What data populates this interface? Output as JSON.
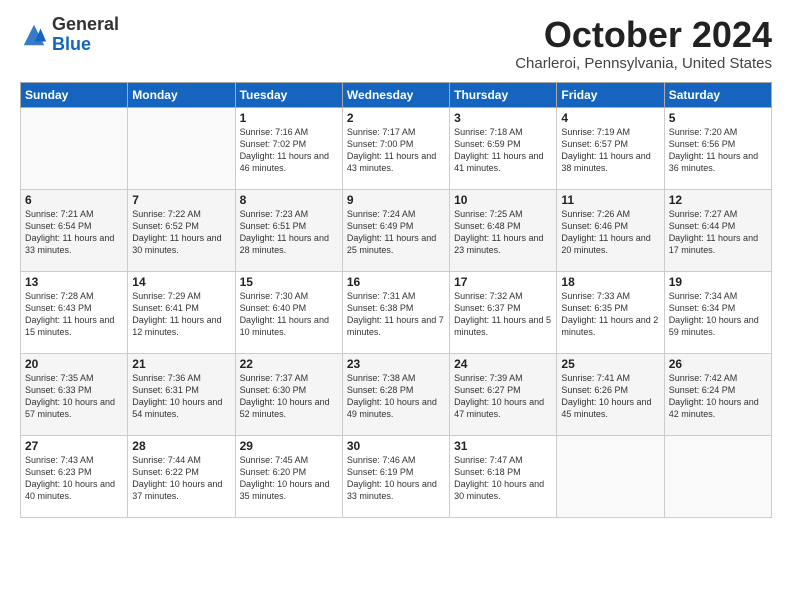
{
  "logo": {
    "general": "General",
    "blue": "Blue"
  },
  "header": {
    "month": "October 2024",
    "location": "Charleroi, Pennsylvania, United States"
  },
  "days_of_week": [
    "Sunday",
    "Monday",
    "Tuesday",
    "Wednesday",
    "Thursday",
    "Friday",
    "Saturday"
  ],
  "weeks": [
    [
      {
        "day": null
      },
      {
        "day": null
      },
      {
        "day": 1,
        "sunrise": "7:16 AM",
        "sunset": "7:02 PM",
        "daylight": "11 hours and 46 minutes."
      },
      {
        "day": 2,
        "sunrise": "7:17 AM",
        "sunset": "7:00 PM",
        "daylight": "11 hours and 43 minutes."
      },
      {
        "day": 3,
        "sunrise": "7:18 AM",
        "sunset": "6:59 PM",
        "daylight": "11 hours and 41 minutes."
      },
      {
        "day": 4,
        "sunrise": "7:19 AM",
        "sunset": "6:57 PM",
        "daylight": "11 hours and 38 minutes."
      },
      {
        "day": 5,
        "sunrise": "7:20 AM",
        "sunset": "6:56 PM",
        "daylight": "11 hours and 36 minutes."
      }
    ],
    [
      {
        "day": 6,
        "sunrise": "7:21 AM",
        "sunset": "6:54 PM",
        "daylight": "11 hours and 33 minutes."
      },
      {
        "day": 7,
        "sunrise": "7:22 AM",
        "sunset": "6:52 PM",
        "daylight": "11 hours and 30 minutes."
      },
      {
        "day": 8,
        "sunrise": "7:23 AM",
        "sunset": "6:51 PM",
        "daylight": "11 hours and 28 minutes."
      },
      {
        "day": 9,
        "sunrise": "7:24 AM",
        "sunset": "6:49 PM",
        "daylight": "11 hours and 25 minutes."
      },
      {
        "day": 10,
        "sunrise": "7:25 AM",
        "sunset": "6:48 PM",
        "daylight": "11 hours and 23 minutes."
      },
      {
        "day": 11,
        "sunrise": "7:26 AM",
        "sunset": "6:46 PM",
        "daylight": "11 hours and 20 minutes."
      },
      {
        "day": 12,
        "sunrise": "7:27 AM",
        "sunset": "6:44 PM",
        "daylight": "11 hours and 17 minutes."
      }
    ],
    [
      {
        "day": 13,
        "sunrise": "7:28 AM",
        "sunset": "6:43 PM",
        "daylight": "11 hours and 15 minutes."
      },
      {
        "day": 14,
        "sunrise": "7:29 AM",
        "sunset": "6:41 PM",
        "daylight": "11 hours and 12 minutes."
      },
      {
        "day": 15,
        "sunrise": "7:30 AM",
        "sunset": "6:40 PM",
        "daylight": "11 hours and 10 minutes."
      },
      {
        "day": 16,
        "sunrise": "7:31 AM",
        "sunset": "6:38 PM",
        "daylight": "11 hours and 7 minutes."
      },
      {
        "day": 17,
        "sunrise": "7:32 AM",
        "sunset": "6:37 PM",
        "daylight": "11 hours and 5 minutes."
      },
      {
        "day": 18,
        "sunrise": "7:33 AM",
        "sunset": "6:35 PM",
        "daylight": "11 hours and 2 minutes."
      },
      {
        "day": 19,
        "sunrise": "7:34 AM",
        "sunset": "6:34 PM",
        "daylight": "10 hours and 59 minutes."
      }
    ],
    [
      {
        "day": 20,
        "sunrise": "7:35 AM",
        "sunset": "6:33 PM",
        "daylight": "10 hours and 57 minutes."
      },
      {
        "day": 21,
        "sunrise": "7:36 AM",
        "sunset": "6:31 PM",
        "daylight": "10 hours and 54 minutes."
      },
      {
        "day": 22,
        "sunrise": "7:37 AM",
        "sunset": "6:30 PM",
        "daylight": "10 hours and 52 minutes."
      },
      {
        "day": 23,
        "sunrise": "7:38 AM",
        "sunset": "6:28 PM",
        "daylight": "10 hours and 49 minutes."
      },
      {
        "day": 24,
        "sunrise": "7:39 AM",
        "sunset": "6:27 PM",
        "daylight": "10 hours and 47 minutes."
      },
      {
        "day": 25,
        "sunrise": "7:41 AM",
        "sunset": "6:26 PM",
        "daylight": "10 hours and 45 minutes."
      },
      {
        "day": 26,
        "sunrise": "7:42 AM",
        "sunset": "6:24 PM",
        "daylight": "10 hours and 42 minutes."
      }
    ],
    [
      {
        "day": 27,
        "sunrise": "7:43 AM",
        "sunset": "6:23 PM",
        "daylight": "10 hours and 40 minutes."
      },
      {
        "day": 28,
        "sunrise": "7:44 AM",
        "sunset": "6:22 PM",
        "daylight": "10 hours and 37 minutes."
      },
      {
        "day": 29,
        "sunrise": "7:45 AM",
        "sunset": "6:20 PM",
        "daylight": "10 hours and 35 minutes."
      },
      {
        "day": 30,
        "sunrise": "7:46 AM",
        "sunset": "6:19 PM",
        "daylight": "10 hours and 33 minutes."
      },
      {
        "day": 31,
        "sunrise": "7:47 AM",
        "sunset": "6:18 PM",
        "daylight": "10 hours and 30 minutes."
      },
      {
        "day": null
      },
      {
        "day": null
      }
    ]
  ]
}
